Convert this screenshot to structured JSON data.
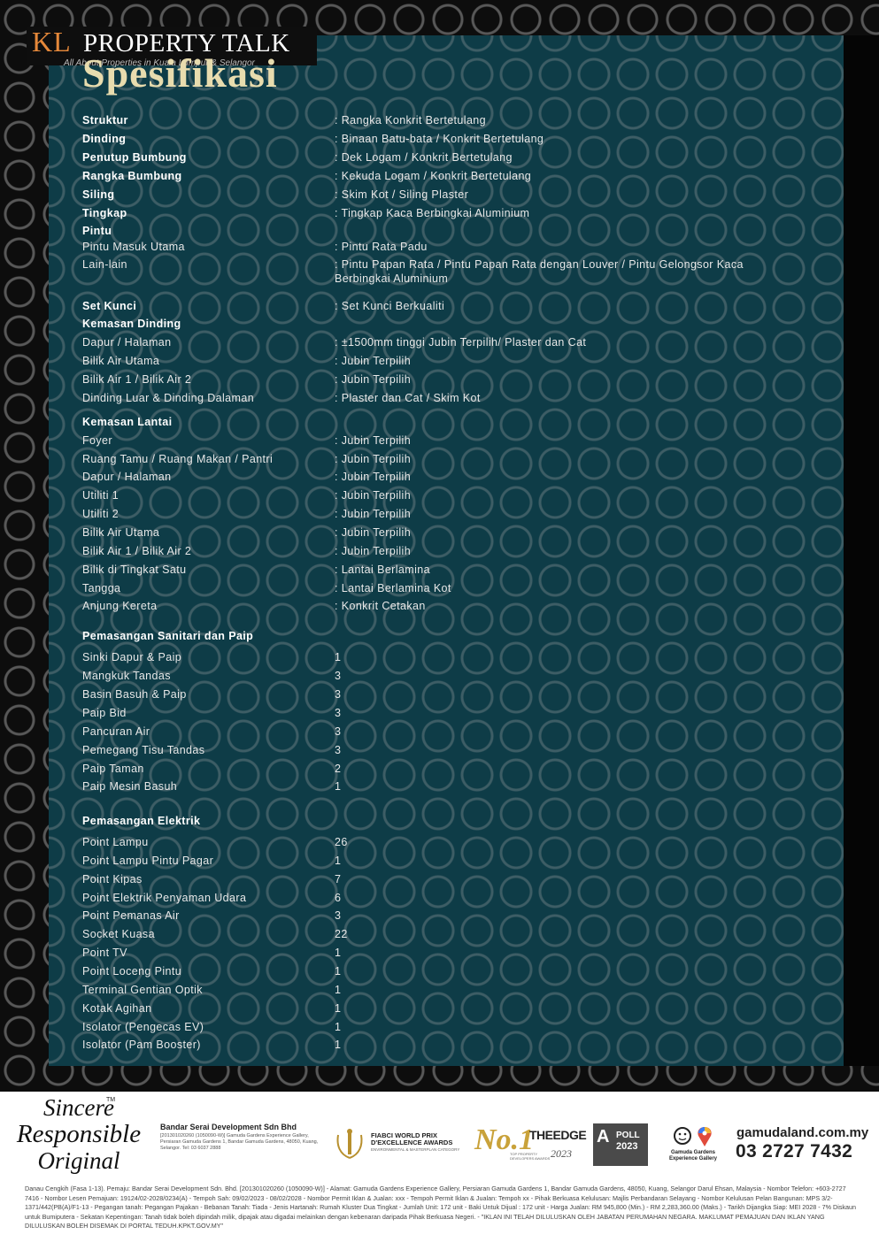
{
  "watermark": {
    "kl": "KL",
    "title": "PROPERTY TALK",
    "tagline": "All About Properties in Kuala Lumpur & Selangor"
  },
  "title": "Spesifikasi",
  "specs": [
    {
      "label": "Struktur",
      "value": ": Rangka Konkrit Bertetulang",
      "bold": true
    },
    {
      "label": "Dinding",
      "value": ": Binaan Batu-bata / Konkrit Bertetulang",
      "bold": true
    },
    {
      "label": "Penutup Bumbung",
      "value": ": Dek Logam / Konkrit Bertetulang",
      "bold": true
    },
    {
      "label": "Rangka Bumbung",
      "value": ": Kekuda Logam / Konkrit Bertetulang",
      "bold": true
    },
    {
      "label": "Siling",
      "value": ": Skim Kot / Siling Plaster",
      "bold": true
    },
    {
      "label": "Tingkap",
      "value": ": Tingkap Kaca Berbingkai Aluminium",
      "bold": true
    },
    {
      "label": "Pintu",
      "value": "",
      "bold": true
    },
    {
      "label": "Pintu Masuk Utama",
      "value": ": Pintu Rata Padu",
      "bold": false
    },
    {
      "label": "Lain-lain",
      "value": ": Pintu Papan Rata / Pintu Papan Rata dengan Louver / Pintu Gelongsor Kaca Berbingkai Aluminium",
      "bold": false
    },
    {
      "label": "Set Kunci",
      "value": ": Set Kunci Berkualiti",
      "bold": true
    },
    {
      "label": "Kemasan Dinding",
      "value": "",
      "bold": true
    },
    {
      "label": "Dapur / Halaman",
      "value": ": ±1500mm tinggi Jubin Terpilih/ Plaster dan Cat",
      "bold": false
    },
    {
      "label": "Bilik Air Utama",
      "value": ": Jubin Terpilih",
      "bold": false
    },
    {
      "label": "Bilik Air 1 / Bilik Air 2",
      "value": ": Jubin Terpilih",
      "bold": false
    },
    {
      "label": "Dinding Luar & Dinding Dalaman",
      "value": ": Plaster dan Cat / Skim Kot",
      "bold": false
    },
    {
      "label": "Kemasan Lantai",
      "value": "",
      "bold": true
    },
    {
      "label": "Foyer",
      "value": ": Jubin Terpilih",
      "bold": false
    },
    {
      "label": "Ruang Tamu / Ruang Makan / Pantri",
      "value": ": Jubin Terpilih",
      "bold": false
    },
    {
      "label": "Dapur / Halaman",
      "value": ": Jubin Terpilih",
      "bold": false
    },
    {
      "label": "Utiliti 1",
      "value": ": Jubin Terpilih",
      "bold": false
    },
    {
      "label": "Utiliti 2",
      "value": ": Jubin Terpilih",
      "bold": false
    },
    {
      "label": "Bilik Air Utama",
      "value": ": Jubin Terpilih",
      "bold": false
    },
    {
      "label": "Bilik Air 1 / Bilik Air 2",
      "value": ": Jubin Terpilih",
      "bold": false
    },
    {
      "label": "Bilik di Tingkat Satu",
      "value": ": Lantai Berlamina",
      "bold": false
    },
    {
      "label": "Tangga",
      "value": ": Lantai Berlamina Kot",
      "bold": false
    },
    {
      "label": "Anjung Kereta",
      "value": ": Konkrit Cetakan",
      "bold": false
    },
    {
      "label": "Pemasangan Sanitari dan Paip",
      "value": "",
      "bold": true
    },
    {
      "label": "Sinki Dapur & Paip",
      "value": "1",
      "bold": false
    },
    {
      "label": "Mangkuk Tandas",
      "value": "3",
      "bold": false
    },
    {
      "label": "Basin Basuh & Paip",
      "value": "3",
      "bold": false
    },
    {
      "label": "Paip Bid",
      "value": "3",
      "bold": false
    },
    {
      "label": "Pancuran Air",
      "value": "3",
      "bold": false
    },
    {
      "label": "Pemegang Tisu Tandas",
      "value": "3",
      "bold": false
    },
    {
      "label": "Paip Taman",
      "value": "2",
      "bold": false
    },
    {
      "label": "Paip Mesin Basuh",
      "value": "1",
      "bold": false
    },
    {
      "label": "Pemasangan Elektrik",
      "value": "",
      "bold": true
    },
    {
      "label": "Point Lampu",
      "value": "26",
      "bold": false
    },
    {
      "label": "Point Lampu Pintu Pagar",
      "value": "1",
      "bold": false
    },
    {
      "label": "Point Kipas",
      "value": "7",
      "bold": false
    },
    {
      "label": "Point Elektrik Penyaman Udara",
      "value": "6",
      "bold": false
    },
    {
      "label": "Point Pemanas Air",
      "value": "3",
      "bold": false
    },
    {
      "label": "Socket Kuasa",
      "value": "22",
      "bold": false
    },
    {
      "label": "Point TV",
      "value": "1",
      "bold": false
    },
    {
      "label": "Point Loceng Pintu",
      "value": "1",
      "bold": false
    },
    {
      "label": "Terminal Gentian Optik",
      "value": "1",
      "bold": false
    },
    {
      "label": "Kotak Agihan",
      "value": "1",
      "bold": false
    },
    {
      "label": "Isolator (Pengecas EV)",
      "value": "1",
      "bold": false
    },
    {
      "label": "Isolator (Pam Booster)",
      "value": "1",
      "bold": false
    }
  ],
  "footer": {
    "slogan_1": "Sincere",
    "slogan_2": "Responsible",
    "slogan_3": "Original",
    "tm": "TM",
    "developer_name": "Bandar Serai Development Sdn Bhd",
    "developer_details": "[201301020260 (1050090-W)] Gamuda Gardens Experience Gallery, Persiaran Gamuda Gardens 1, Bandar Gamuda Gardens, 48050, Kuang, Selangor. Tel: 03 6037 2888",
    "fiabci_title": "FIABCI WORLD PRIX D'EXCELLENCE AWARDS",
    "fiabci_sub": "ENVIRONMENTAL & MASTERPLAN CATEGORY",
    "edge_no1": "No.1",
    "edge_name": "THEEDGE",
    "edge_sub": "TOP PROPERTY DEVELOPERS AWARDS",
    "edge_year": "2023",
    "poll_letter": "A",
    "poll_word": "POLL",
    "poll_year": "2023",
    "gallery_label": "Gamuda Gardens Experience Gallery",
    "website": "gamudaland.com.my",
    "phone": "03 2727 7432",
    "disclaimer": "Danau Cengkih (Fasa 1-13). Pemaju: Bandar Serai Development Sdn. Bhd. [201301020260 (1050090-W)] - Alamat: Gamuda Gardens Experience Gallery, Persiaran Gamuda Gardens 1, Bandar Gamuda Gardens, 48050, Kuang, Selangor Darul Ehsan, Malaysia - Nombor Telefon: +603-2727 7416 - Nombor Lesen Pemajuan: 19124/02-2028/0234(A) - Tempoh Sah: 09/02/2023 - 08/02/2028 - Nombor Permit Iklan & Jualan: xxx - Tempoh Permit Iklan & Jualan: Tempoh xx - Pihak Berkuasa Kelulusan: Majlis Perbandaran Selayang - Nombor Kelulusan Pelan Bangunan: MPS 3/2-1371/442(PB(A)/F1-13 - Pegangan tanah: Pegangan Pajakan - Bebanan Tanah: Tiada - Jenis Hartanah: Rumah Kluster Dua Tingkat - Jumlah Unit: 172 unit - Baki Untuk Dijual : 172 unit - Harga Jualan: RM 945,800 (Min.) - RM 2,283,360.00 (Maks.) - Tarikh Dijangka Siap: MEI 2028 - 7% Diskaun untuk Bumiputera - Sekatan Kepentingan: Tanah tidak boleh dipindah milik, dipajak atau digadai melainkan dengan kebenaran daripada Pihak Berkuasa Negeri. - \"IKLAN INI TELAH DILULUSKAN OLEH JABATAN PERUMAHAN NEGARA. MAKLUMAT PEMAJUAN DAN IKLAN YANG DILULUSKAN BOLEH DISEMAK DI PORTAL TEDUH.KPKT.GOV.MY\""
  }
}
